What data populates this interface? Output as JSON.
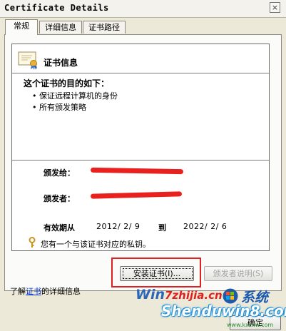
{
  "window": {
    "title": "Certificate Details",
    "close_glyph": "×"
  },
  "tabs": [
    {
      "label": "常规",
      "active": true
    },
    {
      "label": "详细信息",
      "active": false
    },
    {
      "label": "证书路径",
      "active": false
    }
  ],
  "cert": {
    "header": "证书信息",
    "purpose_heading": "这个证书的目的如下：",
    "purposes": [
      "保证远程计算机的身份",
      "所有颁发策略"
    ],
    "bullet": "•",
    "issued_to_label": "颁发给：",
    "issued_by_label": "颁发者：",
    "valid_from_label": "有效期从",
    "valid_from": "2012/ 2/ 9",
    "valid_to_label": "到",
    "valid_to": "2022/ 2/ 6",
    "private_key_note": "您有一个与该证书对应的私钥。"
  },
  "buttons": {
    "install": "安装证书(I)...",
    "issuer_statement": "颁发者说明(S)",
    "ok": "确定"
  },
  "footer": {
    "learn_prefix": "了解",
    "learn_link": "证书",
    "learn_suffix": "的详细信息"
  },
  "watermark": {
    "line1_a": "Win",
    "line1_b": "7zhijia.cn",
    "line2": "Shenduwin8.com",
    "cjk": "系统",
    "small": "www.kxzxw.com"
  },
  "colors": {
    "annotation_red": "#e02020",
    "link_blue": "#0033cc",
    "redaction": "#e8201e"
  }
}
